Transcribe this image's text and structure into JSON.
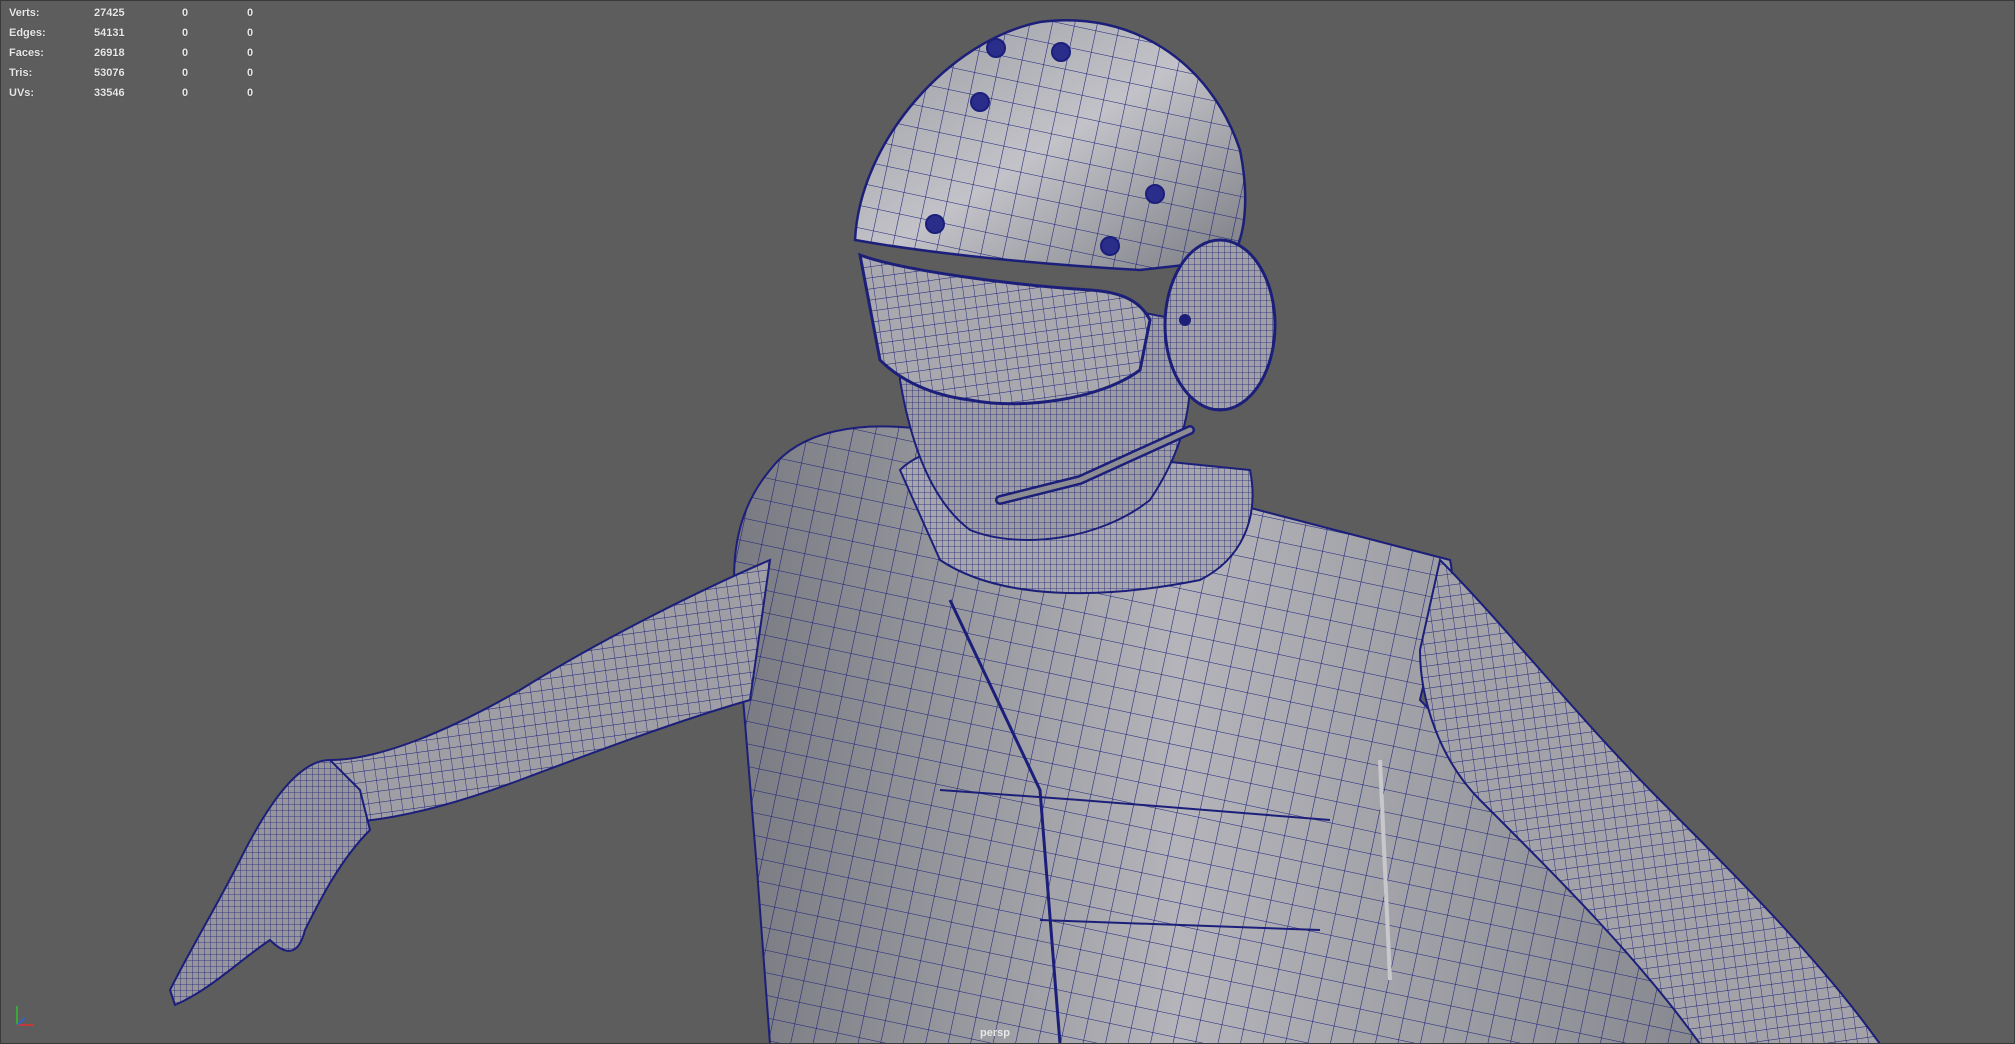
{
  "hud": {
    "rows": [
      {
        "label": "Verts:",
        "total": "27425",
        "selected": "0",
        "component": "0"
      },
      {
        "label": "Edges:",
        "total": "54131",
        "selected": "0",
        "component": "0"
      },
      {
        "label": "Faces:",
        "total": "26918",
        "selected": "0",
        "component": "0"
      },
      {
        "label": "Tris:",
        "total": "53076",
        "selected": "0",
        "component": "0"
      },
      {
        "label": "UVs:",
        "total": "33546",
        "selected": "0",
        "component": "0"
      }
    ]
  },
  "viewport": {
    "camera": "persp",
    "background_color": "#5d5d5d",
    "wire_color": "#1c1f7a",
    "shade_color": "#9a9aa0"
  },
  "axis_icon": {
    "name": "view-axis-icon",
    "colors": {
      "x": "#e03030",
      "y": "#30c030",
      "z": "#3060e0"
    }
  }
}
